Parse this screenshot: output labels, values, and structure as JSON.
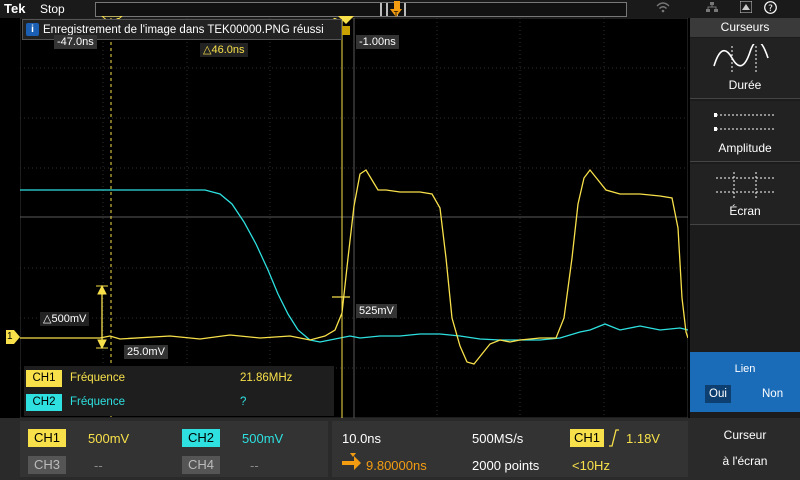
{
  "app": {
    "logo": "Tek",
    "state": "Stop"
  },
  "notification": {
    "icon": "info-icon",
    "text": "Enregistrement de l'image dans TEK00000.PNG réussi"
  },
  "cursors": {
    "left_time": "-47.0ns",
    "delta_time": "△46.0ns",
    "right_time": "-1.00ns",
    "delta_ampl": "△500mV",
    "left_ampl": "25.0mV",
    "right_ampl": "525mV"
  },
  "channel_marker": "1",
  "measurements": [
    {
      "channel": "CH1",
      "name": "Fréquence",
      "value": "21.86MHz",
      "color": "#f7e04a"
    },
    {
      "channel": "CH2",
      "name": "Fréquence",
      "value": "?",
      "color": "#2ee0e0"
    }
  ],
  "bottom": {
    "ch1_label": "CH1",
    "ch1_scale": "500mV",
    "ch2_label": "CH2",
    "ch2_scale": "500mV",
    "ch3_label": "CH3",
    "ch3_scale": "--",
    "ch4_label": "CH4",
    "ch4_scale": "--",
    "timebase": "10.0ns",
    "sample_rate": "500MS/s",
    "delay": "9.80000ns",
    "record_length": "2000 points",
    "trigger_channel": "CH1",
    "trigger_level": "1.18V",
    "trigger_freq": "<10Hz"
  },
  "side_menu": {
    "title": "Curseurs",
    "items": [
      {
        "label": "Durée"
      },
      {
        "label": "Amplitude"
      },
      {
        "label": "Écran"
      }
    ],
    "lien": {
      "title": "Lien",
      "oui": "Oui",
      "non": "Non"
    },
    "screen_cursor": {
      "line1": "Curseur",
      "line2": "à l'écran"
    }
  },
  "colors": {
    "ch1": "#f7e04a",
    "ch2": "#2ee0e0",
    "accent": "#1a6bb8"
  }
}
